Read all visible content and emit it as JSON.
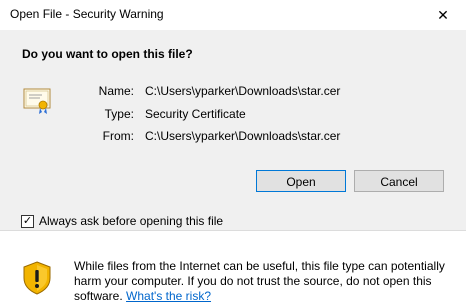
{
  "window": {
    "title": "Open File - Security Warning",
    "close_glyph": "✕"
  },
  "dialog": {
    "question": "Do you want to open this file?",
    "fields": [
      {
        "label": "Name:",
        "value": "C:\\Users\\yparker\\Downloads\\star.cer"
      },
      {
        "label": "Type:",
        "value": "Security Certificate"
      },
      {
        "label": "From:",
        "value": "C:\\Users\\yparker\\Downloads\\star.cer"
      }
    ],
    "buttons": {
      "open": "Open",
      "cancel": "Cancel"
    },
    "checkbox": {
      "label": "Always ask before opening this file",
      "checked": true,
      "check_glyph": "✓"
    }
  },
  "footer": {
    "warning_text": "While files from the Internet can be useful, this file type can potentially harm your computer. If you do not trust the source, do not open this software.",
    "link_text": "What's the risk?"
  },
  "icons": {
    "file": "certificate-icon",
    "warning": "shield-warning-icon"
  },
  "colors": {
    "content_bg": "#f0f0f0",
    "default_button_border": "#0078d7",
    "link": "#0066cc",
    "shield_yellow": "#f2b400"
  }
}
